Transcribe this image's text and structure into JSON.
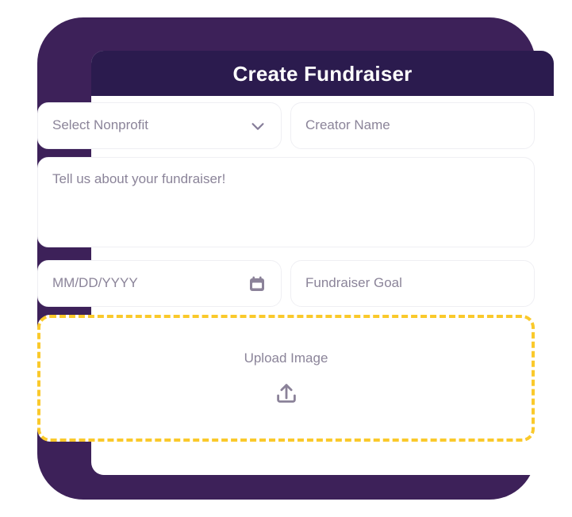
{
  "window": {
    "frame_color": "#3D2159",
    "card_background": "#FFFFFF"
  },
  "header": {
    "title": "Create Fundraiser",
    "background_color": "#2B1B4E",
    "text_color": "#FFFFFF"
  },
  "form": {
    "placeholder_color": "#8B8499",
    "field_border_color": "#EFEFF3",
    "fields": [
      {
        "name": "nonprofit",
        "type": "select",
        "placeholder": "Select Nonprofit",
        "value": "",
        "icon": "chevron-down-icon"
      },
      {
        "name": "creator",
        "type": "text",
        "placeholder": "Creator Name",
        "value": ""
      },
      {
        "name": "description",
        "type": "textarea",
        "placeholder": "Tell us about your fundraiser!",
        "value": ""
      },
      {
        "name": "date",
        "type": "date",
        "placeholder": "MM/DD/YYYY",
        "value": "",
        "icon": "calendar-icon"
      },
      {
        "name": "goal",
        "type": "text",
        "placeholder": "Fundraiser Goal",
        "value": ""
      }
    ]
  },
  "upload": {
    "label": "Upload Image",
    "icon": "upload-icon",
    "border_color": "#FAC92B",
    "border_style": "dashed"
  }
}
